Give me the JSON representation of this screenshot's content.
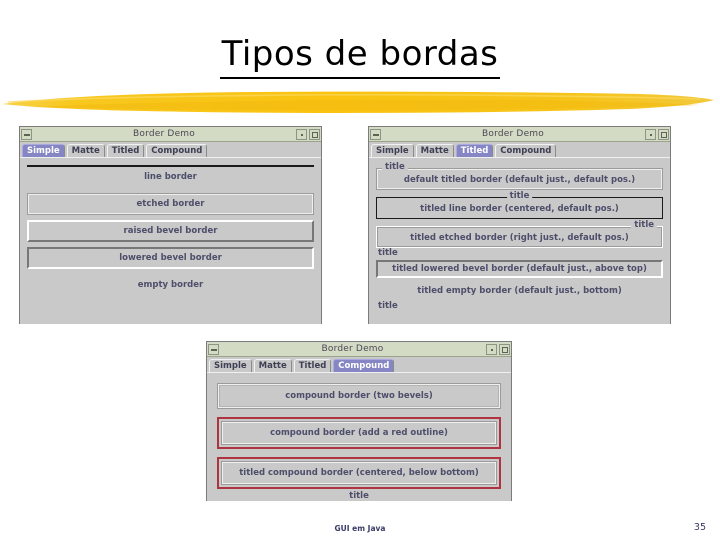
{
  "slide": {
    "title": "Tipos de bordas",
    "footer": "GUI em Java",
    "page_number": "35",
    "accent_yellow": "#F5C518",
    "tab_active_color": "#8686C4",
    "red_outline_color": "#B0343F",
    "titlebar_color": "#D3DBC5",
    "window_bg_color": "#C9C9C9",
    "text_color": "#4E4E6B"
  },
  "windows": [
    {
      "title": "Border Demo",
      "tabs": [
        {
          "label": "Simple",
          "active": true
        },
        {
          "label": "Matte",
          "active": false
        },
        {
          "label": "Titled",
          "active": false
        },
        {
          "label": "Compound",
          "active": false
        }
      ],
      "samples": [
        {
          "label": "line border"
        },
        {
          "label": "etched border"
        },
        {
          "label": "raised bevel border"
        },
        {
          "label": "lowered bevel border"
        },
        {
          "label": "empty border"
        }
      ]
    },
    {
      "title": "Border Demo",
      "tabs": [
        {
          "label": "Simple",
          "active": false
        },
        {
          "label": "Matte",
          "active": false
        },
        {
          "label": "Titled",
          "active": true
        },
        {
          "label": "Compound",
          "active": false
        }
      ],
      "samples": [
        {
          "title_label": "title",
          "label": "default titled border (default just., default pos.)"
        },
        {
          "title_label": "title",
          "label": "titled line border (centered, default pos.)"
        },
        {
          "title_label": "title",
          "label": "titled etched border (right just., default pos.)"
        },
        {
          "title_label": "title",
          "label": "titled lowered bevel border (default just., above top)"
        },
        {
          "title_label": "title",
          "label": "titled empty border (default just., bottom)"
        }
      ]
    },
    {
      "title": "Border Demo",
      "tabs": [
        {
          "label": "Simple",
          "active": false
        },
        {
          "label": "Matte",
          "active": false
        },
        {
          "label": "Titled",
          "active": false
        },
        {
          "label": "Compound",
          "active": true
        }
      ],
      "samples": [
        {
          "label": "compound border (two bevels)"
        },
        {
          "label": "compound border (add a red outline)"
        },
        {
          "label": "titled compound border (centered, below bottom)",
          "title_label": "title"
        }
      ]
    }
  ]
}
